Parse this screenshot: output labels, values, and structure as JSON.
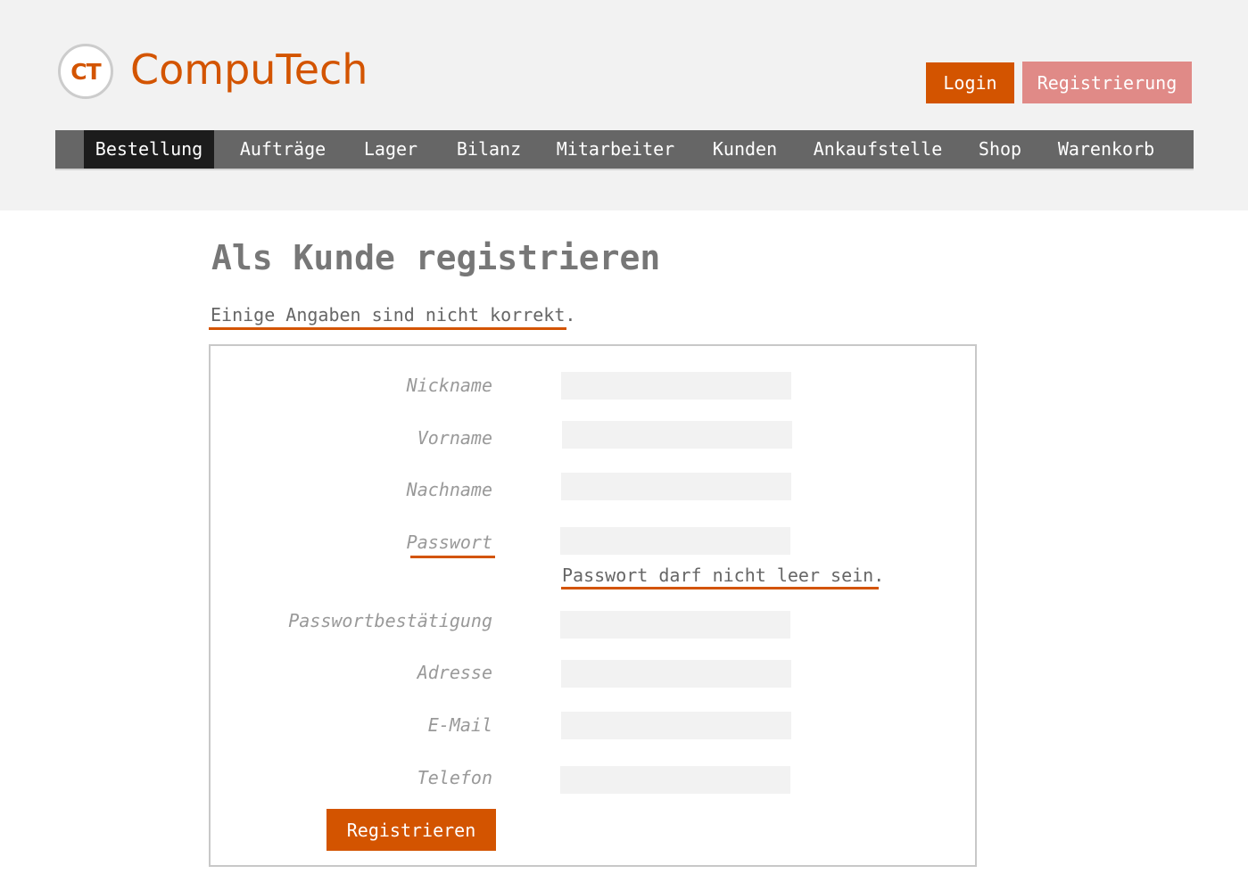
{
  "brand": {
    "logo_text": "CT",
    "name": "CompuTech"
  },
  "header": {
    "login_label": "Login",
    "register_label": "Registrierung"
  },
  "nav": {
    "items": [
      {
        "label": "Bestellung",
        "active": true
      },
      {
        "label": "Aufträge"
      },
      {
        "label": "Lager"
      },
      {
        "label": "Bilanz"
      },
      {
        "label": "Mitarbeiter"
      },
      {
        "label": "Kunden"
      },
      {
        "label": "Ankaufstelle"
      },
      {
        "label": "Shop"
      },
      {
        "label": "Warenkorb"
      }
    ]
  },
  "main": {
    "title": "Als Kunde registrieren",
    "error_summary": "Einige Angaben sind nicht korrekt."
  },
  "form": {
    "fields": [
      {
        "label": "Nickname",
        "value": ""
      },
      {
        "label": "Vorname",
        "value": ""
      },
      {
        "label": "Nachname",
        "value": ""
      },
      {
        "label": "Passwort",
        "value": "",
        "error": "Passwort darf nicht leer sein."
      },
      {
        "label": "Passwortbestätigung",
        "value": ""
      },
      {
        "label": "Adresse",
        "value": ""
      },
      {
        "label": "E-Mail",
        "value": ""
      },
      {
        "label": "Telefon",
        "value": ""
      }
    ],
    "submit_label": "Registrieren"
  },
  "colors": {
    "accent": "#d35400",
    "accent_light": "#e08a87",
    "nav_bg": "#666666",
    "nav_active": "#1c1c1c",
    "header_bg": "#f2f2f2",
    "input_bg": "#f2f2f2"
  }
}
